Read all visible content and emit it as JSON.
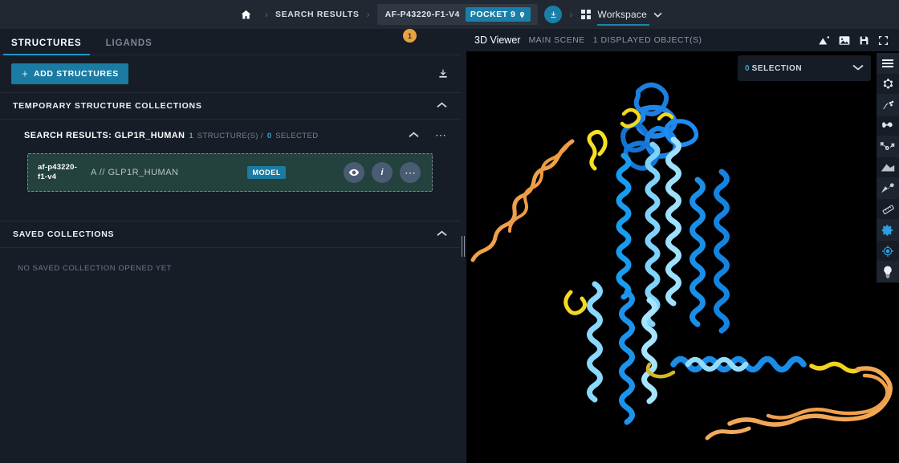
{
  "topbar": {
    "home_icon": "home-icon",
    "breadcrumb_search": "SEARCH RESULTS",
    "structure_id": "AF-P43220-F1-V4",
    "pocket_label": "POCKET 9",
    "pocket_icon": "map-pin-icon",
    "download_icon": "download-icon",
    "workspace_label": "Workspace",
    "workspace_icon": "grid-icon",
    "workspace_caret": "chevron-down-icon",
    "separator": "›"
  },
  "left_panel": {
    "tabs": [
      {
        "label": "STRUCTURES",
        "active": true
      },
      {
        "label": "LIGANDS",
        "active": false
      }
    ],
    "add_structures_label": "ADD STRUCTURES",
    "add_structures_icon": "plus-icon",
    "export_icon": "download-icon",
    "temporary_section": {
      "title": "TEMPORARY STRUCTURE COLLECTIONS",
      "collapse_icon": "chevron-up-icon"
    },
    "collection": {
      "title": "SEARCH RESULTS: GLP1R_HUMAN",
      "structure_count": "1",
      "structure_count_label": "STRUCTURE(S) /",
      "selected_count": "0",
      "selected_count_label": "SELECTED",
      "collapse_icon": "chevron-up-icon",
      "more_icon": "ellipsis-icon"
    },
    "structure_card": {
      "id": "af-p43220-f1-v4",
      "chain": "A // GLP1R_HUMAN",
      "tag": "MODEL",
      "buttons": [
        {
          "name": "visibility-button",
          "glyph": "◉",
          "icon": "eye-icon"
        },
        {
          "name": "info-button",
          "glyph": "i",
          "icon": "info-icon"
        },
        {
          "name": "more-button",
          "glyph": "⋯",
          "icon": "ellipsis-icon"
        }
      ]
    },
    "saved_section": {
      "title": "SAVED COLLECTIONS",
      "collapse_icon": "chevron-up-icon",
      "empty_text": "NO SAVED COLLECTION OPENED YET"
    }
  },
  "viewer": {
    "title": "3D Viewer",
    "scene": "MAIN SCENE",
    "objects": "1 DISPLAYED OBJECT(S)",
    "header_icons": [
      "reset-view-icon",
      "screenshot-icon",
      "save-icon",
      "fullscreen-icon"
    ],
    "selection": {
      "count": "0",
      "label": "SELECTION",
      "caret": "chevron-down-icon"
    },
    "badge_count": "1",
    "tools": [
      "menu-icon",
      "molecule-icon",
      "ribbon-molecule-icon",
      "cartoon-ribbon-icon",
      "water-molecule-icon",
      "surface-icon",
      "distance-measure-icon",
      "ruler-icon",
      "settings-gear-icon",
      "target-icon",
      "lightbulb-icon"
    ]
  },
  "colors": {
    "accent": "#1a7ba3",
    "accent_text": "#3fa4d8",
    "badge": "#e8a33d",
    "card_bg": "#23423d",
    "panel_bg": "#161d27",
    "topbar_bg": "#222831",
    "canvas_bg": "#000000"
  }
}
